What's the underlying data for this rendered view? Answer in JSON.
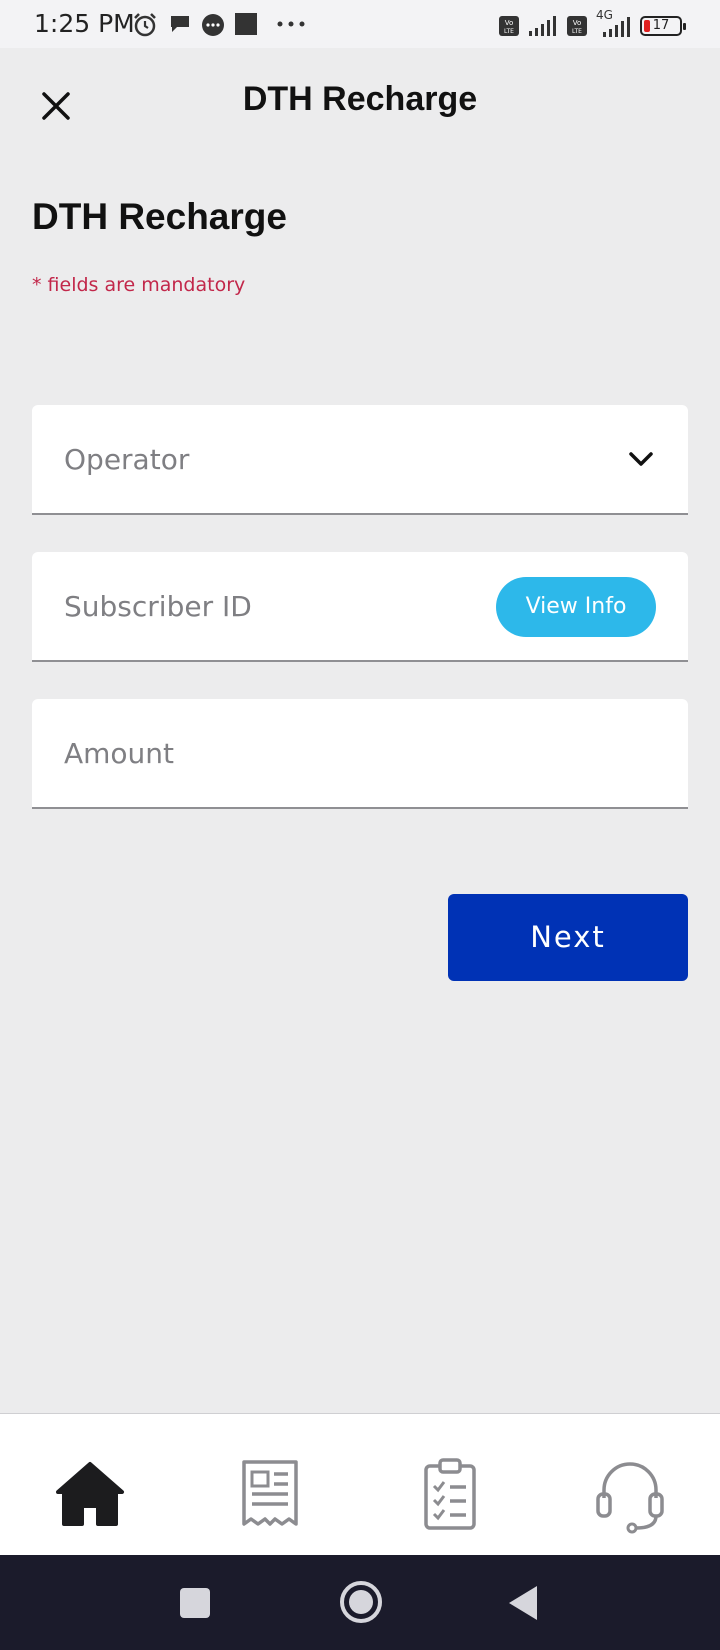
{
  "status_bar": {
    "time": "1:25 PM",
    "icons": [
      "alarm-icon",
      "chat-icon",
      "message-icon",
      "square-icon",
      "more-dots-icon",
      "volte-icon",
      "signal-icon",
      "volte-icon",
      "4g-signal-icon",
      "battery-icon"
    ],
    "network_label": "4G",
    "battery_level": "17",
    "battery_color": "#e02020"
  },
  "header": {
    "title": "DTH Recharge",
    "close_icon": "close-icon"
  },
  "form": {
    "title": "DTH Recharge",
    "mandatory_note": "* fields are mandatory",
    "operator": {
      "placeholder": "Operator",
      "icon": "chevron-down-icon"
    },
    "subscriber_id": {
      "placeholder": "Subscriber ID",
      "view_info_label": "View Info"
    },
    "amount": {
      "placeholder": "Amount"
    },
    "next_label": "Next"
  },
  "bottom_nav": {
    "items": [
      {
        "icon": "home-icon",
        "active": true
      },
      {
        "icon": "receipt-icon",
        "active": false
      },
      {
        "icon": "clipboard-checklist-icon",
        "active": false
      },
      {
        "icon": "headset-support-icon",
        "active": false
      }
    ]
  },
  "system_nav": [
    "recent-apps-icon",
    "home-circle-icon",
    "back-triangle-icon"
  ],
  "colors": {
    "accent": "#0032b5",
    "info_button": "#2db8ea",
    "mandatory": "#c2274a",
    "background": "#ececed"
  }
}
